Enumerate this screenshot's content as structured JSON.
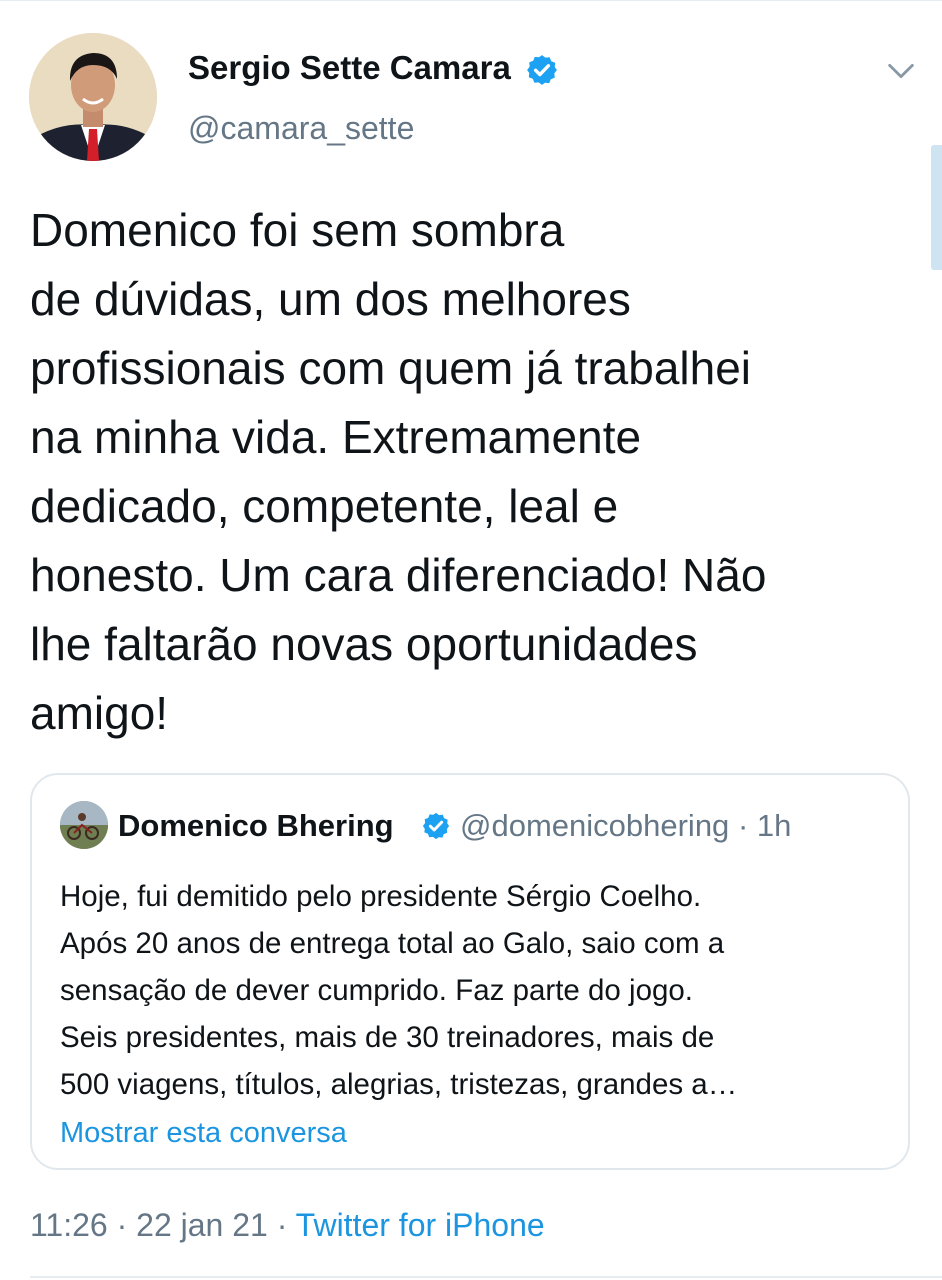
{
  "tweet": {
    "author": {
      "name": "Sergio Sette Camara",
      "handle": "@camara_sette",
      "verified": true,
      "avatar_icon": "profile-photo"
    },
    "menu_icon": "chevron-down-icon",
    "text": "Domenico foi sem sombra\nde dúvidas, um dos melhores\nprofissionais com quem já trabalhei\nna minha vida. Extremamente\ndedicado, competente, leal e\nhonesto. Um cara diferenciado! Não\nlhe faltarão novas oportunidades\namigo!",
    "quoted": {
      "name": "Domenico Bhering",
      "verified": true,
      "handle": "@domenicobhering",
      "separator": "·",
      "time": "1h",
      "text": "Hoje, fui demitido pelo presidente Sérgio Coelho.\nApós 20 anos de entrega total ao Galo, saio com a\nsensação de dever cumprido. Faz parte do jogo.\nSeis presidentes, mais de 30 treinadores, mais de\n500 viagens, títulos, alegrias, tristezas, grandes a…",
      "show_thread": "Mostrar esta conversa"
    },
    "meta": {
      "time": "11:26",
      "sep1": " · ",
      "date": "22 jan 21",
      "sep2": " · ",
      "source": "Twitter for iPhone"
    }
  },
  "colors": {
    "text": "#0f1419",
    "secondary": "#657786",
    "link": "#1b95e0",
    "verified": "#1da1f2",
    "border": "#e1e8ed"
  }
}
